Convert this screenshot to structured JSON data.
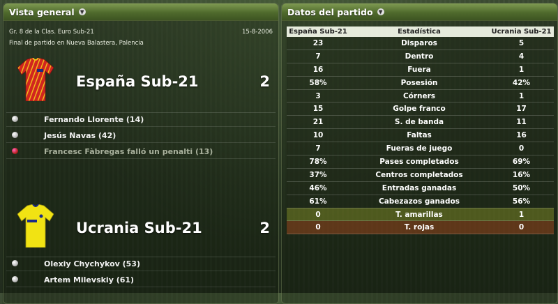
{
  "left_panel": {
    "title": "Vista general",
    "competition": "Gr. 8 de la Clas. Euro Sub-21",
    "date": "15-8-2006",
    "venue": "Final de partido en Nueva Balastera, Palencia",
    "home": {
      "name": "España Sub-21",
      "score": "2",
      "kit_colors": {
        "shirt": "#d1261f",
        "stripe": "#f3c21b",
        "trim": "#1b2b80"
      },
      "events": [
        {
          "text": "Fernando Llorente (14)",
          "type": "goal"
        },
        {
          "text": "Jesús Navas (42)",
          "type": "goal"
        },
        {
          "text": "Francesc Fàbregas falló un penalti (13)",
          "type": "missed-penalty"
        }
      ]
    },
    "away": {
      "name": "Ucrania Sub-21",
      "score": "2",
      "kit_colors": {
        "shirt": "#f1e313",
        "trim": "#1a2a8a"
      },
      "events": [
        {
          "text": "Olexiy Chychykov (53)",
          "type": "goal"
        },
        {
          "text": "Artem Milevskiy (61)",
          "type": "goal"
        }
      ]
    }
  },
  "right_panel": {
    "title": "Datos del partido",
    "headers": {
      "home": "España Sub-21",
      "stat": "Estadística",
      "away": "Ucrania Sub-21"
    },
    "rows": [
      {
        "home": "23",
        "stat": "Disparos",
        "away": "5"
      },
      {
        "home": "7",
        "stat": "Dentro",
        "away": "4"
      },
      {
        "home": "16",
        "stat": "Fuera",
        "away": "1"
      },
      {
        "home": "58%",
        "stat": "Posesión",
        "away": "42%"
      },
      {
        "home": "3",
        "stat": "Córners",
        "away": "1"
      },
      {
        "home": "15",
        "stat": "Golpe franco",
        "away": "17"
      },
      {
        "home": "21",
        "stat": "S. de banda",
        "away": "11"
      },
      {
        "home": "10",
        "stat": "Faltas",
        "away": "16"
      },
      {
        "home": "7",
        "stat": "Fueras de juego",
        "away": "0"
      },
      {
        "home": "78%",
        "stat": "Pases completados",
        "away": "69%"
      },
      {
        "home": "37%",
        "stat": "Centros completados",
        "away": "16%"
      },
      {
        "home": "46%",
        "stat": "Entradas ganadas",
        "away": "50%"
      },
      {
        "home": "61%",
        "stat": "Cabezazos ganados",
        "away": "56%"
      },
      {
        "home": "0",
        "stat": "T. amarillas",
        "away": "1",
        "highlight": "yellow"
      },
      {
        "home": "0",
        "stat": "T. rojas",
        "away": "0",
        "highlight": "red"
      }
    ]
  }
}
